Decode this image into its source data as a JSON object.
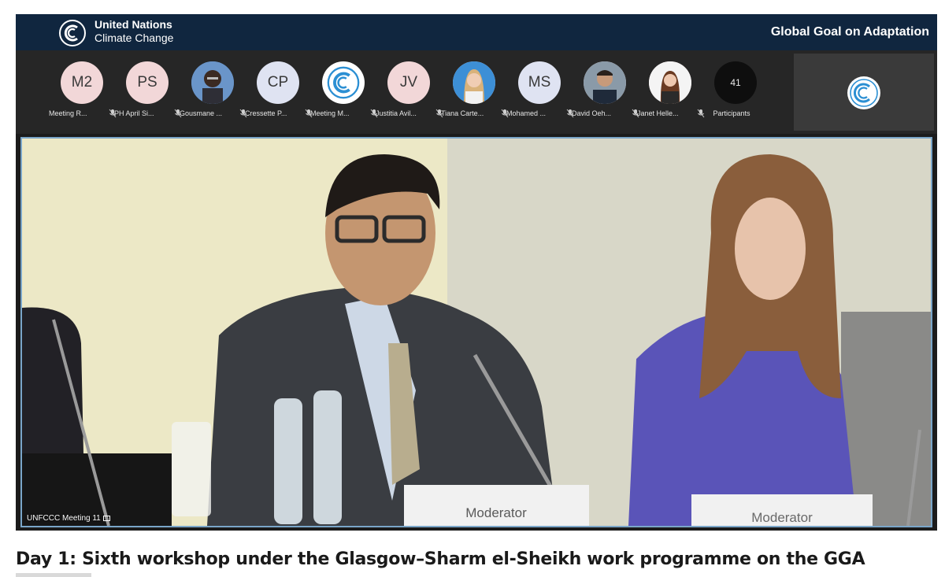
{
  "window": {
    "org_name_line1": "United Nations",
    "org_name_line2": "Climate Change",
    "event_title": "Global Goal on Adaptation"
  },
  "participants": [
    {
      "initials": "M2",
      "name": "Meeting R...",
      "kind": "initials",
      "muted": true
    },
    {
      "initials": "PS",
      "name": "PH April Si...",
      "kind": "initials",
      "muted": true
    },
    {
      "initials": "",
      "name": "Gousmane ...",
      "kind": "photo",
      "muted": true
    },
    {
      "initials": "CP",
      "name": "Cressette P...",
      "kind": "initials",
      "muted": true
    },
    {
      "initials": "",
      "name": "Meeting M...",
      "kind": "logo",
      "muted": true
    },
    {
      "initials": "JV",
      "name": "Justitia Avil...",
      "kind": "initials",
      "muted": true
    },
    {
      "initials": "",
      "name": "Tiana Carte...",
      "kind": "photo",
      "muted": true
    },
    {
      "initials": "MS",
      "name": "Mohamed ...",
      "kind": "initials-blue",
      "muted": true
    },
    {
      "initials": "",
      "name": "David Oeh...",
      "kind": "photo",
      "muted": true
    },
    {
      "initials": "",
      "name": "Janet Helle...",
      "kind": "photo",
      "muted": true
    }
  ],
  "participant_count": {
    "value": "41",
    "label": "Participants"
  },
  "main_video": {
    "tile_label": "UNFCCC Meeting 11",
    "nameplate_left": "Moderator",
    "nameplate_right": "Moderator"
  },
  "caption": "Day 1: Sixth workshop under the Glasgow–Sharm el-Sheikh work programme on the GGA",
  "colors": {
    "header_bg": "#10263f",
    "strip_bg": "#262626",
    "active_border": "#7aa6c9",
    "avatar_pink": "#f2d7d8"
  },
  "icons": [
    "un-climate-logo-icon",
    "mic-muted-icon",
    "camera-icon"
  ]
}
